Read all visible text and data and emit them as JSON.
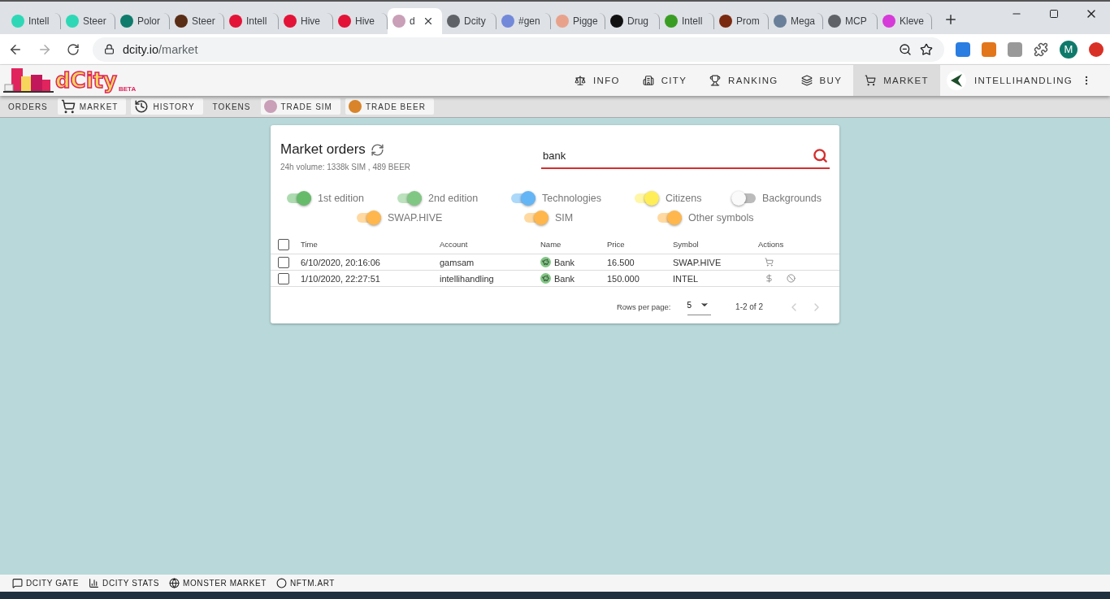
{
  "browser": {
    "tabs": [
      {
        "title": "Intell",
        "color": "#2ed8b6",
        "selected": false
      },
      {
        "title": "Steer",
        "color": "#2ed8b6",
        "selected": false
      },
      {
        "title": "Polor",
        "color": "#0f7b6c",
        "selected": false
      },
      {
        "title": "Steer",
        "color": "#5a2d16",
        "selected": false
      },
      {
        "title": "Intell",
        "color": "#e31337",
        "selected": false
      },
      {
        "title": "Hive",
        "color": "#e31337",
        "selected": false
      },
      {
        "title": "Hive",
        "color": "#e31337",
        "selected": false
      },
      {
        "title": "d",
        "color": "#c9a0b8",
        "selected": true
      },
      {
        "title": "Dcity",
        "color": "#5f6368",
        "selected": false
      },
      {
        "title": "#gen",
        "color": "#7289da",
        "selected": false
      },
      {
        "title": "Pigge",
        "color": "#e8a28c",
        "selected": false
      },
      {
        "title": "Drug",
        "color": "#111111",
        "selected": false
      },
      {
        "title": "Intell",
        "color": "#3a9d23",
        "selected": false
      },
      {
        "title": "Prom",
        "color": "#7a2a10",
        "selected": false
      },
      {
        "title": "Mega",
        "color": "#6a7f99",
        "selected": false
      },
      {
        "title": "MCP",
        "color": "#5f6368",
        "selected": false
      },
      {
        "title": "Kleve",
        "color": "#d63ad8",
        "selected": false
      }
    ],
    "url_host": "dcity.io",
    "url_path": "/market",
    "profile_initial": "M"
  },
  "app": {
    "logo": {
      "name": "dCity",
      "badge": "BETA"
    },
    "nav": [
      {
        "label": "INFO",
        "selected": false
      },
      {
        "label": "CITY",
        "selected": false
      },
      {
        "label": "RANKING",
        "selected": false
      },
      {
        "label": "BUY",
        "selected": false
      },
      {
        "label": "MARKET",
        "selected": true
      }
    ],
    "user": "INTELLIHANDLING",
    "subnav": [
      {
        "kind": "label",
        "label": "ORDERS"
      },
      {
        "kind": "button",
        "label": "MARKET"
      },
      {
        "kind": "button",
        "label": "HISTORY"
      },
      {
        "kind": "label",
        "label": "TOKENS"
      },
      {
        "kind": "button",
        "label": "TRADE SIM"
      },
      {
        "kind": "button",
        "label": "TRADE BEER"
      }
    ]
  },
  "market": {
    "title": "Market orders",
    "volume": "24h volume: 1338k SIM , 489 BEER",
    "search": {
      "value": "bank"
    },
    "filters": [
      {
        "label": "1st edition",
        "on": true,
        "color": "#66bb6a"
      },
      {
        "label": "2nd edition",
        "on": true,
        "color": "#81c784"
      },
      {
        "label": "Technologies",
        "on": true,
        "color": "#64b5f6"
      },
      {
        "label": "Citizens",
        "on": true,
        "color": "#ffee58"
      },
      {
        "label": "Backgrounds",
        "on": false
      }
    ],
    "symbol_filters": [
      {
        "label": "SWAP.HIVE",
        "on": true,
        "color": "#ffb74d"
      },
      {
        "label": "SIM",
        "on": true,
        "color": "#ffb74d"
      },
      {
        "label": "Other symbols",
        "on": true,
        "color": "#ffb74d"
      }
    ],
    "table": {
      "all_checked": false,
      "columns": [
        "Time",
        "Account",
        "Name",
        "Price",
        "Symbol",
        "Actions"
      ],
      "rows": [
        {
          "checked": false,
          "time": "6/10/2020, 20:16:06",
          "account": "gamsam",
          "name": "Bank",
          "price": "16.500",
          "symbol": "SWAP.HIVE",
          "actions": [
            {
              "kind": "buy"
            }
          ]
        },
        {
          "checked": false,
          "time": "1/10/2020, 22:27:51",
          "account": "intellihandling",
          "name": "Bank",
          "price": "150.000",
          "symbol": "INTEL",
          "actions": [
            {
              "kind": "price"
            },
            {
              "kind": "cancel"
            }
          ]
        }
      ]
    },
    "pagination": {
      "rows_label": "Rows per page:",
      "rows_value": "5",
      "range": "1-2 of 2"
    }
  },
  "footer": [
    "DCITY GATE",
    "DCITY STATS",
    "MONSTER MARKET",
    "NFTM.ART"
  ]
}
